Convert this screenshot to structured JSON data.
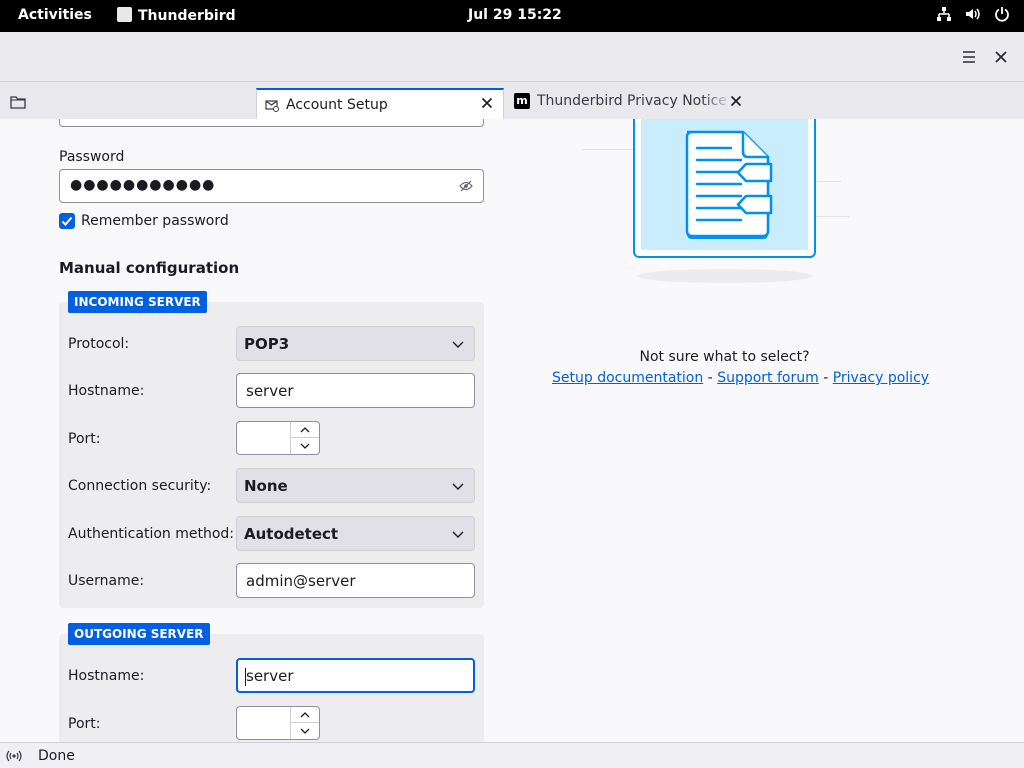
{
  "topbar": {
    "activities": "Activities",
    "app_name": "Thunderbird",
    "clock": "Jul 29  15:22"
  },
  "tabs": [
    {
      "title": "Account Setup",
      "icon": "account-setup-icon",
      "active": true
    },
    {
      "title": "Thunderbird Privacy Notice — ",
      "icon": "mozilla-m-icon",
      "active": false
    }
  ],
  "form": {
    "password_label": "Password",
    "password_value": "●●●●●●●●●●●",
    "remember_label": "Remember password",
    "remember_checked": true,
    "manual_title": "Manual configuration",
    "incoming": {
      "badge": "INCOMING SERVER",
      "protocol_label": "Protocol:",
      "protocol_value": "POP3",
      "hostname_label": "Hostname:",
      "hostname_value": "server",
      "port_label": "Port:",
      "port_value": "",
      "security_label": "Connection security:",
      "security_value": "None",
      "auth_label": "Authentication method:",
      "auth_value": "Autodetect",
      "username_label": "Username:",
      "username_value": "admin@server"
    },
    "outgoing": {
      "badge": "OUTGOING SERVER",
      "hostname_label": "Hostname:",
      "hostname_value": "server",
      "port_label": "Port:",
      "port_value": ""
    }
  },
  "help": {
    "question": "Not sure what to select?",
    "link_docs": "Setup documentation",
    "sep1": " - ",
    "link_forum": "Support forum",
    "sep2": " - ",
    "link_privacy": "Privacy policy"
  },
  "status": {
    "text": "Done"
  },
  "colors": {
    "accent": "#0060df",
    "illustration_blue": "#0090ed",
    "illustration_fill": "#c9edfd"
  }
}
